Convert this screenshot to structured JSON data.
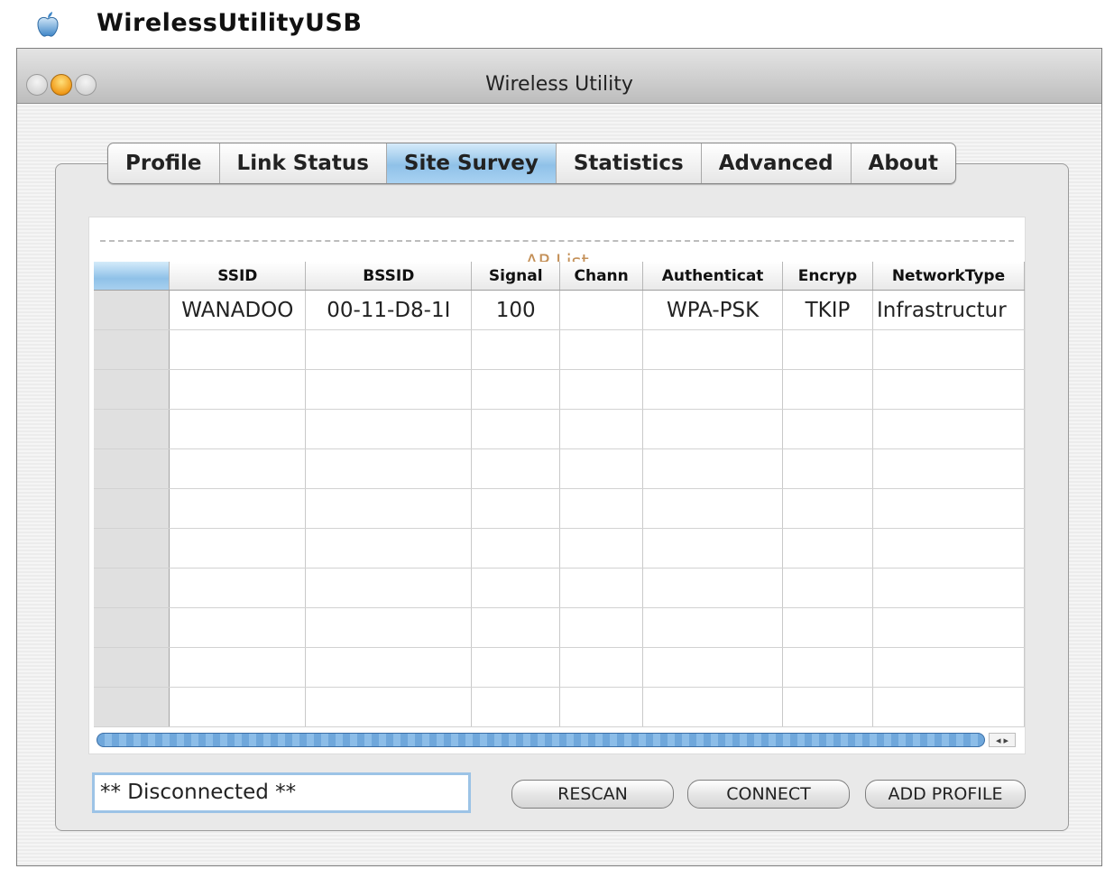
{
  "menubar": {
    "app_name": "WirelessUtilityUSB"
  },
  "window": {
    "title": "Wireless Utility"
  },
  "tabs": [
    {
      "label": "Profile"
    },
    {
      "label": "Link Status"
    },
    {
      "label": "Site Survey",
      "active": true
    },
    {
      "label": "Statistics"
    },
    {
      "label": "Advanced"
    },
    {
      "label": "About"
    }
  ],
  "ap_list": {
    "legend": "AP List",
    "columns": [
      "",
      "SSID",
      "BSSID",
      "Signal",
      "Chann",
      "Authenticat",
      "Encryp",
      "NetworkType"
    ],
    "rows": [
      {
        "ssid": "WANADOO",
        "bssid": "00-11-D8-1I",
        "signal": "100",
        "channel": "",
        "auth": "WPA-PSK",
        "encryption": "TKIP",
        "network_type": "Infrastructur"
      }
    ],
    "empty_rows": 10
  },
  "status": {
    "text": "** Disconnected **"
  },
  "buttons": {
    "rescan": "RESCAN",
    "connect": "CONNECT",
    "add_profile": "ADD PROFILE"
  },
  "colors": {
    "active_tab": "#8fc1e8",
    "legend_text": "#c49058",
    "scrollbar": "#6fa7db",
    "minimize_light": "#f09a1a"
  }
}
